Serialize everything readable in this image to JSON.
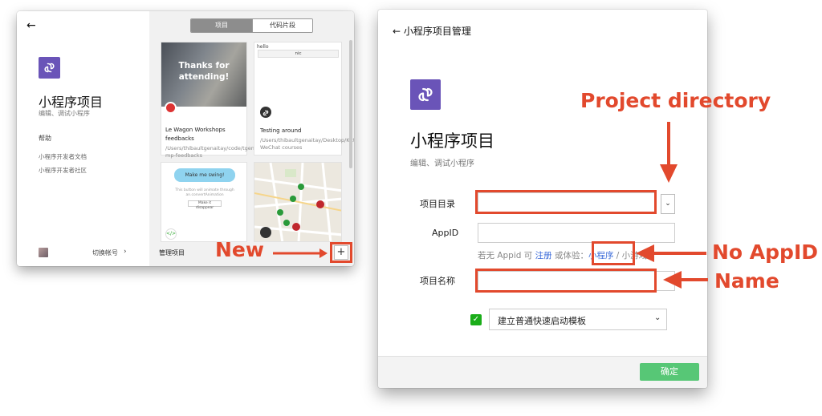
{
  "left_window": {
    "back_icon": "arrow-left-icon",
    "logo_icon": "miniprogram-logo-icon",
    "title": "小程序项目",
    "subtitle": "编辑、调试小程序",
    "help_heading": "帮助",
    "help_links": [
      "小程序开发者文档",
      "小程序开发者社区"
    ],
    "switch_account": "切换帐号",
    "switch_arrow": "›",
    "tabs": [
      {
        "label": "项目",
        "active": true
      },
      {
        "label": "代码片段",
        "active": false
      }
    ],
    "cards": [
      {
        "image_text": "Thanks for attending!",
        "title": "Le Wagon Workshops feedbacks",
        "path": "/Users/thibaultgenaitay/code/tgenaitay/wagon-mp-feedbacks"
      },
      {
        "preview_hello": "hello",
        "preview_bar": "nic",
        "title": "Testing around",
        "path": "/Users/thibaultgenaitay/Desktop/Kitt WeChat courses"
      },
      {
        "preview_button": "Make me swing!",
        "preview_text": "This button will animate through an.convertAnimation",
        "preview_small": "Make it disappear",
        "badge": "</>"
      },
      {
        "type": "map"
      }
    ],
    "manage_label": "管理项目",
    "plus_label": "+"
  },
  "right_window": {
    "back_label": "小程序项目管理",
    "back_arrow": "←",
    "title": "小程序项目",
    "subtitle": "编辑、调试小程序",
    "dir_label": "项目目录",
    "dir_value": "",
    "dir_dropdown": "⌄",
    "appid_label": "AppID",
    "appid_value": "",
    "hint_pre": "若无 Appid 可 ",
    "hint_register": "注册",
    "hint_mid": " 或体验：",
    "hint_mini": "小程序",
    "hint_post": " / 小游戏",
    "name_label": "项目名称",
    "name_value": "",
    "template_checked": true,
    "template_check": "✓",
    "template_option": "建立普通快速启动模板",
    "template_chevron": "⌄",
    "confirm_label": "确定"
  },
  "annotations": {
    "new": "New",
    "project_directory": "Project directory",
    "no_appid": "No AppID",
    "name": "Name",
    "color": "#e2492d"
  }
}
